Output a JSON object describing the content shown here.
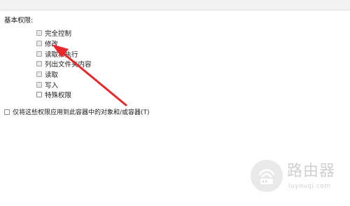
{
  "section_title": "基本权限:",
  "permissions": [
    {
      "label": "完全控制",
      "enabled": false
    },
    {
      "label": "修改",
      "enabled": false
    },
    {
      "label": "读取和执行",
      "enabled": false
    },
    {
      "label": "列出文件夹内容",
      "enabled": false
    },
    {
      "label": "读取",
      "enabled": false
    },
    {
      "label": "写入",
      "enabled": false
    },
    {
      "label": "特殊权限",
      "enabled": true
    }
  ],
  "apply_option": {
    "label": "仅将这些权限应用到此容器中的对象和/或容器(T)",
    "checked": false
  },
  "annotation_arrow_color": "#e8282b",
  "watermark": {
    "name": "路由器",
    "url": "luyouqi.com"
  }
}
